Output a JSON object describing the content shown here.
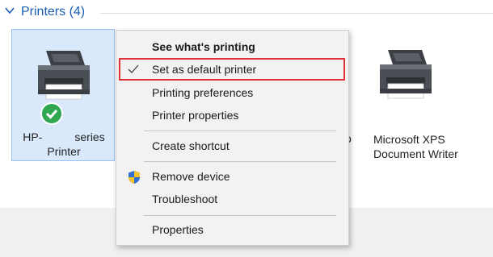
{
  "group": {
    "title": "Printers (4)"
  },
  "selected_printer": {
    "name_line1_prefix": "HP-",
    "name_line1_suffix": "series",
    "name_line2": "Printer",
    "is_default": true
  },
  "other_printer": {
    "name_line1": "Microsoft XPS",
    "name_line2": "Document Writer",
    "partial_label": "o"
  },
  "context_menu": {
    "items": [
      {
        "label": "See what's printing",
        "bold": true
      },
      {
        "label": "Set as default printer",
        "checked": true,
        "highlighted": true
      },
      {
        "label": "Printing preferences"
      },
      {
        "label": "Printer properties"
      },
      {
        "label": "Create shortcut"
      },
      {
        "label": "Remove device",
        "icon": "uac-shield-icon"
      },
      {
        "label": "Troubleshoot"
      },
      {
        "label": "Properties"
      }
    ]
  },
  "colors": {
    "group_title": "#1a5fb4",
    "selection_fill": "#d9e8fb",
    "selection_border": "#99c2f0",
    "highlight_border": "#e0323a",
    "default_badge": "#2fa84f"
  }
}
